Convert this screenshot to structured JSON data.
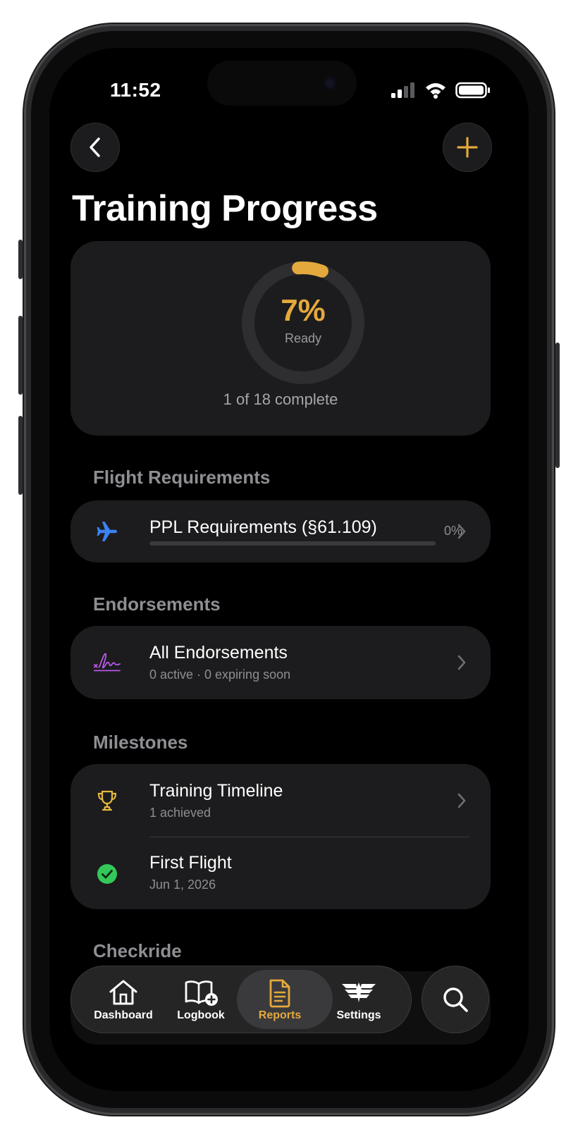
{
  "status_bar": {
    "time": "11:52"
  },
  "header": {
    "title": "Training Progress"
  },
  "summary": {
    "percent_label": "7%",
    "percent_value": 0.07,
    "status": "Ready",
    "completion_text": "1 of 18 complete",
    "accent_color": "#e4a93c"
  },
  "sections": {
    "flight_requirements": {
      "label": "Flight Requirements",
      "item_title": "PPL Requirements (§61.109)",
      "item_percent": "0%",
      "item_progress": 0.0,
      "icon": "airplane-icon",
      "icon_color": "#3b82f6"
    },
    "endorsements": {
      "label": "Endorsements",
      "item_title": "All Endorsements",
      "item_sub": "0 active · 0 expiring soon",
      "icon": "signature-icon",
      "icon_color": "#bf5af2"
    },
    "milestones": {
      "label": "Milestones",
      "timeline_title": "Training Timeline",
      "timeline_sub": "1 achieved",
      "timeline_icon": "trophy-icon",
      "first_flight_title": "First Flight",
      "first_flight_date": "Jun 1, 2026",
      "first_flight_icon": "check-circle-icon",
      "check_color": "#34c759"
    },
    "checkride": {
      "label": "Checkride"
    }
  },
  "tabbar": {
    "tabs": [
      {
        "label": "Dashboard",
        "icon": "house-icon"
      },
      {
        "label": "Logbook",
        "icon": "book-plus-icon"
      },
      {
        "label": "Reports",
        "icon": "document-icon",
        "active": true
      },
      {
        "label": "Settings",
        "icon": "wings-icon"
      }
    ],
    "search_icon": "search-icon"
  }
}
